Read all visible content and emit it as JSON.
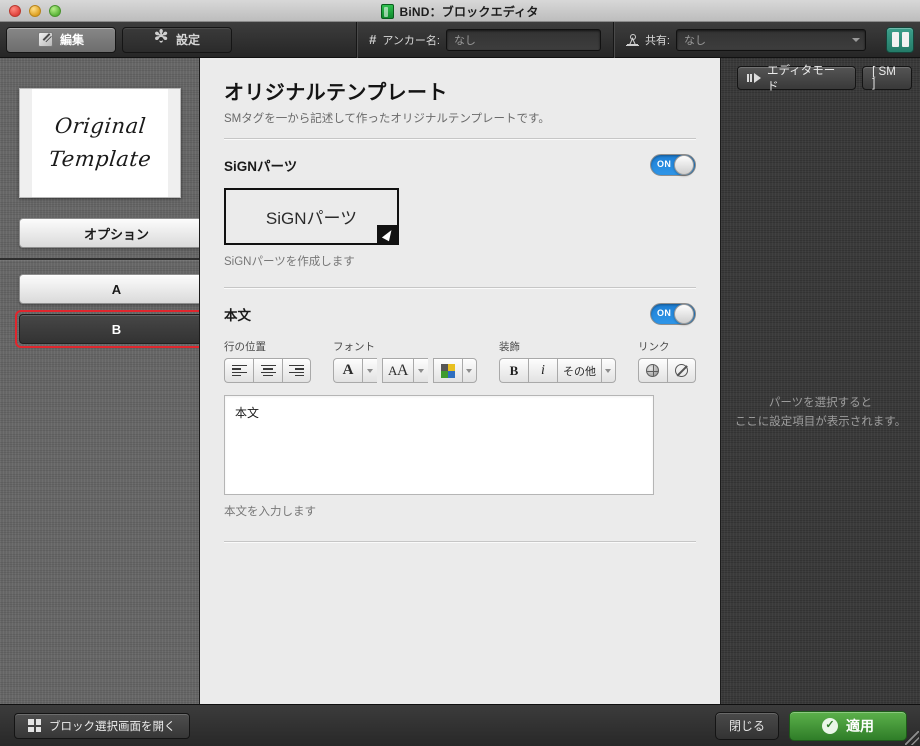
{
  "window": {
    "title": "BiND：ブロックエディタ",
    "app_icon": "bind-book-icon",
    "traffic_lights": [
      "close",
      "minimize",
      "zoom"
    ]
  },
  "toolbar": {
    "tabs": [
      {
        "label": "編集",
        "icon": "pencil-icon",
        "active": true
      },
      {
        "label": "設定",
        "icon": "gear-icon",
        "active": false
      }
    ],
    "anchor": {
      "icon": "hash-icon",
      "label": "アンカー名:",
      "value": "なし",
      "placeholder": "なし"
    },
    "share": {
      "icon": "share-icon",
      "label": "共有:",
      "value": "なし",
      "placeholder": "なし"
    },
    "book_button": {
      "icon": "book-icon"
    },
    "accent_teal": "#2f8f78"
  },
  "sidebar": {
    "thumbnail": {
      "line1": "Original",
      "line2": "Template"
    },
    "option_button": "オプション",
    "items": [
      {
        "label": "A",
        "selected": false
      },
      {
        "label": "B",
        "selected": true
      }
    ],
    "selection_color": "#e0262d"
  },
  "main": {
    "title": "オリジナルテンプレート",
    "subtitle": "SMタグを一から記述して作ったオリジナルテンプレートです。",
    "sections": [
      {
        "title": "SiGNパーツ",
        "toggle": "ON",
        "box_label": "SiGNパーツ",
        "caption": "SiGNパーツを作成します"
      },
      {
        "title": "本文",
        "toggle": "ON",
        "textarea_value": "本文",
        "caption": "本文を入力します"
      }
    ],
    "editor_toolbar": {
      "groups": [
        {
          "label": "行の位置",
          "buttons": [
            {
              "icon": "align-left-icon"
            },
            {
              "icon": "align-center-icon"
            },
            {
              "icon": "align-right-icon"
            }
          ]
        },
        {
          "label": "フォント",
          "buttons": [
            {
              "icon": "font-family-icon",
              "glyph": "A"
            },
            {
              "icon": "font-size-icon",
              "glyph": "aA"
            },
            {
              "icon": "font-color-icon"
            }
          ]
        },
        {
          "label": "装飾",
          "buttons": [
            {
              "icon": "bold-icon",
              "glyph": "B"
            },
            {
              "icon": "italic-icon",
              "glyph": "i"
            },
            {
              "icon": "more-icon",
              "glyph": "その他"
            }
          ]
        },
        {
          "label": "リンク",
          "buttons": [
            {
              "icon": "globe-link-icon"
            },
            {
              "icon": "no-link-icon"
            }
          ]
        }
      ],
      "swatch_colors": [
        "#555555",
        "#e8c020",
        "#3f9b2f",
        "#2f6fc0"
      ]
    }
  },
  "right_panel": {
    "editor_mode_button": {
      "label": "エディタモード",
      "icon": "arrow-right-icon"
    },
    "sm_button": {
      "label": "[ SM ]"
    },
    "hint_line1": "パーツを選択すると",
    "hint_line2": "ここに設定項目が表示されます。"
  },
  "bottom_bar": {
    "open_block_button": {
      "label": "ブロック選択画面を開く",
      "icon": "grid-icon"
    },
    "close_button": "閉じる",
    "apply_button": {
      "label": "適用",
      "icon": "check-circle-icon"
    },
    "apply_color": "#3f8f32"
  }
}
